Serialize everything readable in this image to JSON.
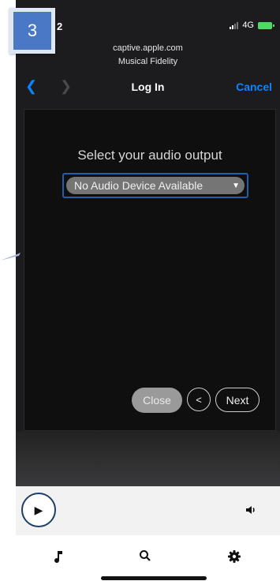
{
  "step_badge": "3",
  "status": {
    "time_fragment": "2",
    "network": "4G"
  },
  "browser": {
    "url_host": "captive.apple.com",
    "site_name": "Musical Fidelity",
    "title": "Log In",
    "cancel_label": "Cancel"
  },
  "page": {
    "prompt": "Select your audio output",
    "selected_output": "No Audio Device Available",
    "close_label": "Close",
    "prev_label": "<",
    "next_label": "Next"
  },
  "colors": {
    "accent": "#0a84ff",
    "select_border": "#1e5fae",
    "badge": "#4a78c4",
    "battery": "#4cd964"
  },
  "icons": {
    "back": "chevron-left-icon",
    "forward": "chevron-right-icon",
    "play": "play-icon",
    "volume": "volume-icon",
    "music": "music-note-icon",
    "search": "search-icon",
    "settings": "gear-icon"
  }
}
